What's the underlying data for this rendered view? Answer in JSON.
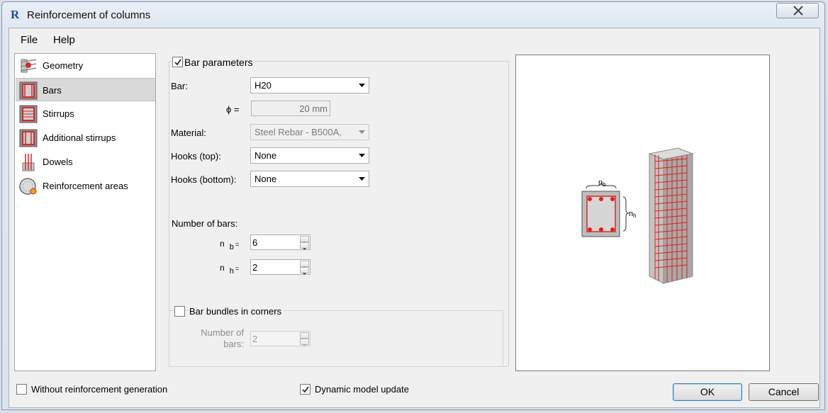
{
  "window": {
    "title": "Reinforcement of columns",
    "app_icon": "R"
  },
  "menu": {
    "file": "File",
    "help": "Help"
  },
  "sidebar": {
    "items": [
      {
        "label": "Geometry",
        "icon": "geometry-icon"
      },
      {
        "label": "Bars",
        "icon": "bars-icon",
        "selected": true
      },
      {
        "label": "Stirrups",
        "icon": "stirrups-icon"
      },
      {
        "label": "Additional stirrups",
        "icon": "additional-stirrups-icon"
      },
      {
        "label": "Dowels",
        "icon": "dowels-icon"
      },
      {
        "label": "Reinforcement areas",
        "icon": "reinforcement-areas-icon"
      }
    ]
  },
  "bar_params": {
    "checkbox_label": "Bar parameters",
    "checked": true,
    "bar_label": "Bar:",
    "bar_value": "H20",
    "phi_label": "ϕ =",
    "phi_value": "20 mm",
    "material_label": "Material:",
    "material_value": "Steel Rebar - B500A,",
    "hooks_top_label": "Hooks (top):",
    "hooks_top_value": "None",
    "hooks_bottom_label": "Hooks (bottom):",
    "hooks_bottom_value": "None",
    "number_of_bars_label": "Number of bars:",
    "nb_main": "n",
    "nb_sub": "b",
    "nb_eq": "=",
    "nb_value": "6",
    "nh_main": "n",
    "nh_sub": "h",
    "nh_eq": "=",
    "nh_value": "2"
  },
  "bundles": {
    "checkbox_label": "Bar bundles in corners",
    "checked": false,
    "number_label_line1": "Number of",
    "number_label_line2": "bars:",
    "number_value": "2"
  },
  "preview": {
    "dim_b": "n",
    "dim_b_sub": "b",
    "dim_h": "n",
    "dim_h_sub": "h"
  },
  "footer": {
    "without_generation_label": "Without reinforcement generation",
    "without_generation_checked": false,
    "dynamic_update_label": "Dynamic model update",
    "dynamic_update_checked": true,
    "ok_label": "OK",
    "cancel_label": "Cancel"
  },
  "colors": {
    "rebar": "#e0201a",
    "concrete": "#b9b9b9",
    "accent": "#3c7fb1"
  }
}
